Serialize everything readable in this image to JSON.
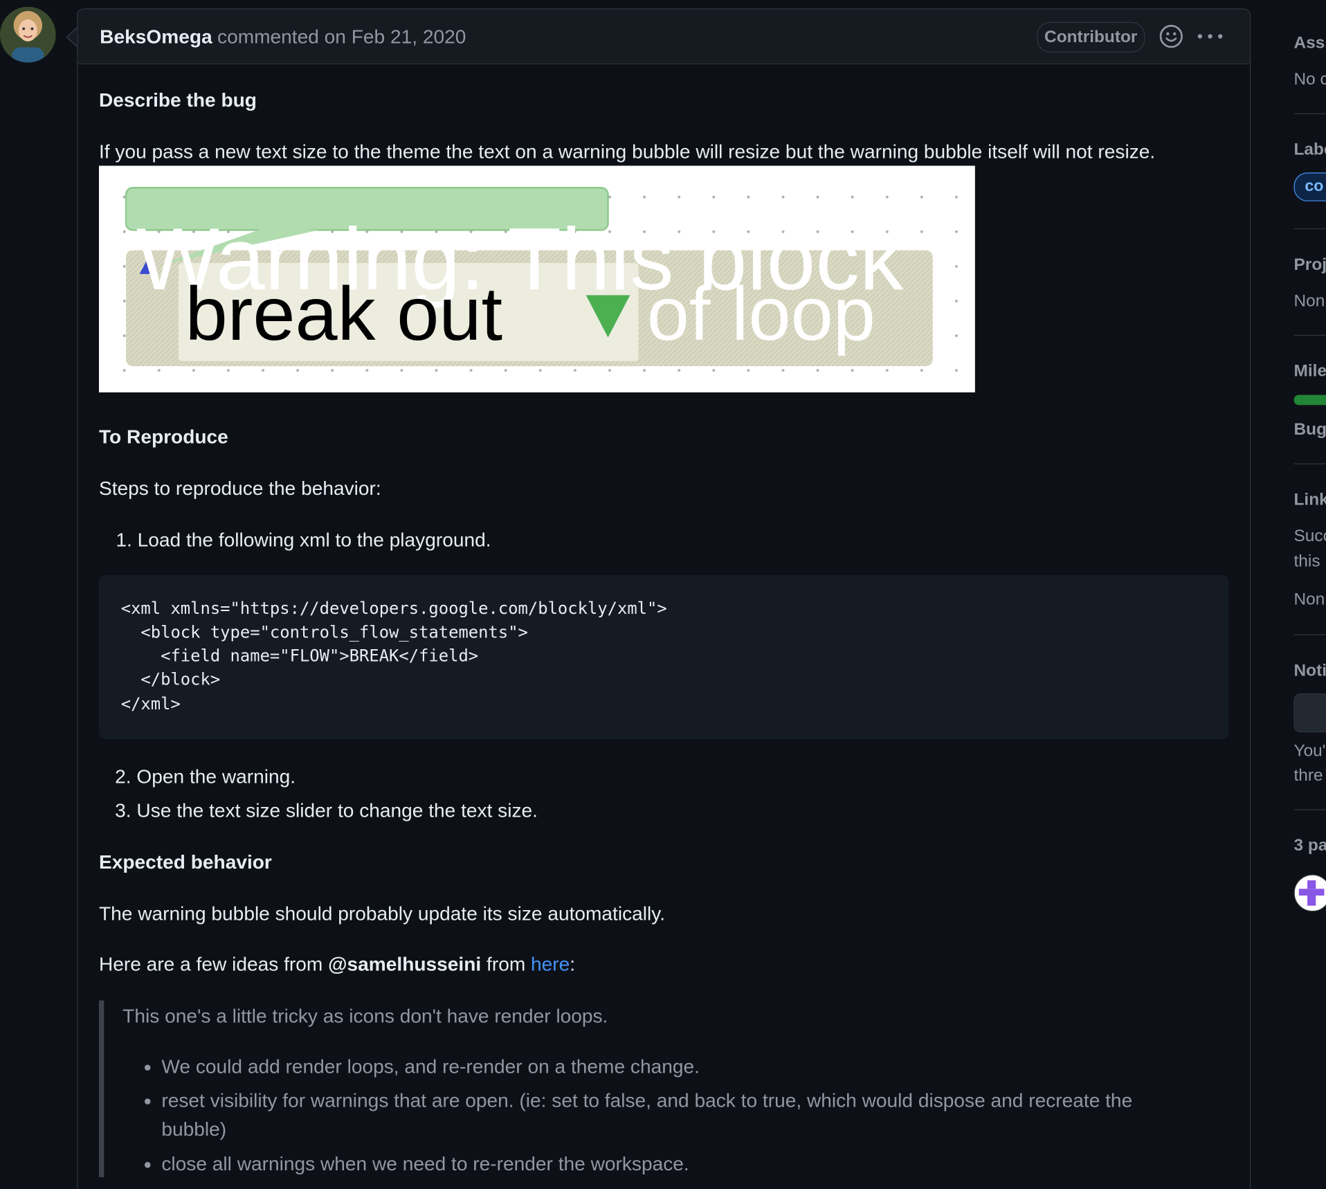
{
  "comment": {
    "author": "BeksOmega",
    "meta": "commented on Feb 21, 2020",
    "badge": "Contributor"
  },
  "body": {
    "h_describe": "Describe the bug",
    "describe_text": "If you pass a new text size to the theme the text on a warning bubble will resize but the warning bubble itself will not resize.",
    "screenshot": {
      "bg_text": "Warning: This block",
      "block_text_1": "break out",
      "block_text_2": "of loop",
      "colors": {
        "bubble": "#b1dcb0",
        "block_bg": "#d6d6c4",
        "label_bg": "#ececdf",
        "arrow": "#4caf50"
      }
    },
    "h_reproduce": "To Reproduce",
    "steps_intro": "Steps to reproduce the behavior:",
    "step1": "1. Load the following xml to the playground.",
    "code_lines": [
      "<xml xmlns=\"https://developers.google.com/blockly/xml\">",
      "  <block type=\"controls_flow_statements\">",
      "    <field name=\"FLOW\">BREAK</field>",
      "  </block>",
      "</xml>"
    ],
    "step2": "2. Open the warning.",
    "step3": "3. Use the text size slider to change the text size.",
    "h_expected": "Expected behavior",
    "expected_text": "The warning bubble should probably update its size automatically.",
    "ideas_prefix": "Here are a few ideas from ",
    "ideas_mention": "@samelhusseini",
    "ideas_middle": " from ",
    "ideas_link": "here",
    "ideas_suffix": ":",
    "quote": {
      "intro": "This one's a little tricky as icons don't have render loops.",
      "bullets": [
        "We could add render loops, and re-render on a theme change.",
        "reset visibility for warnings that are open. (ie: set to false, and back to true, which would dispose and recreate the",
        "bubble)",
        "close all warnings when we need to re-render the workspace."
      ]
    }
  },
  "sidebar": {
    "assignees_h": "Assi",
    "assignees_v": "No c",
    "labels_h": "Labe",
    "label_chip": "co",
    "projects_h": "Proj",
    "projects_v": "Non",
    "milestone_h": "Mile",
    "milestone_v": "Bug",
    "linked_h": "Link",
    "linked_v1": "Succ",
    "linked_v2": "this",
    "linked_v3": "Non",
    "notif_h": "Noti",
    "notif_v1": "You'",
    "notif_v2": "thre",
    "participants_h": "3 pa"
  }
}
